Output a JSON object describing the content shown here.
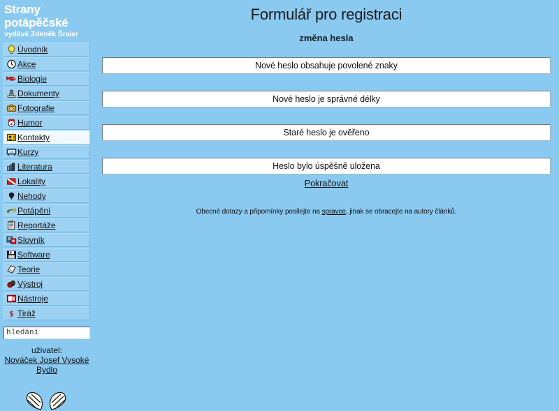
{
  "colors": {
    "background": "#8ac9f0",
    "nav_item": "#9ed2f3",
    "nav_item_active": "#f2fafe",
    "box_background": "#ffffff",
    "box_border": "#6f7b82",
    "brand_text": "#ffffff",
    "body_text": "#101010"
  },
  "sidebar": {
    "brand_line1": "Strany",
    "brand_line2": "potápěčské",
    "brand_subtitle": "vydává Zdeněk Šraier",
    "items": [
      {
        "label": "Úvodník",
        "icon": "lightbulb-icon",
        "active": false
      },
      {
        "label": "Akce",
        "icon": "clock-face-icon",
        "active": false
      },
      {
        "label": "Biologie",
        "icon": "fish-icon",
        "active": false
      },
      {
        "label": "Dokumenty",
        "icon": "stamp-icon",
        "active": false
      },
      {
        "label": "Fotografie",
        "icon": "camera-icon",
        "active": false
      },
      {
        "label": "Humor",
        "icon": "clown-icon",
        "active": false
      },
      {
        "label": "Kontakty",
        "icon": "address-card-icon",
        "active": true
      },
      {
        "label": "Kurzy",
        "icon": "blackboard-icon",
        "active": false
      },
      {
        "label": "Literatura",
        "icon": "books-icon",
        "active": false
      },
      {
        "label": "Lokality",
        "icon": "dive-flag-icon",
        "active": false
      },
      {
        "label": "Nehody",
        "icon": "buoy-icon",
        "active": false
      },
      {
        "label": "Potápění",
        "icon": "diver-icon",
        "active": false
      },
      {
        "label": "Reportáže",
        "icon": "clipboard-icon",
        "active": false
      },
      {
        "label": "Slovník",
        "icon": "dictionary-icon",
        "active": false
      },
      {
        "label": "Software",
        "icon": "floppy-disk-icon",
        "active": false
      },
      {
        "label": "Teorie",
        "icon": "book-icon",
        "active": false
      },
      {
        "label": "Výstroj",
        "icon": "scuba-gear-icon",
        "active": false
      },
      {
        "label": "Nástroje",
        "icon": "tools-icon",
        "active": false
      },
      {
        "label": "Tiráž",
        "icon": "dollar-sign-icon",
        "active": false
      }
    ],
    "search": {
      "placeholder": "hledání",
      "value": ""
    },
    "user": {
      "label": "uživatel:",
      "name": "Nováček Josef Vysoké Bydlo"
    },
    "decoration_icon": "swim-fins-icon"
  },
  "main": {
    "title": "Formulář pro registraci",
    "subtitle": "změna hesla",
    "messages": [
      "Nové heslo obsahuje povolené znaky",
      "Nové heslo je správné délky",
      "Staré heslo je ověřeno",
      "Heslo bylo úspěšně uložena"
    ],
    "continue_link": "Pokračovat",
    "footer": {
      "before_link": "Obecné dotazy a připomínky posílejte na ",
      "link": "spravce",
      "after_link": ", jinak se obracejte na autory článků."
    }
  }
}
